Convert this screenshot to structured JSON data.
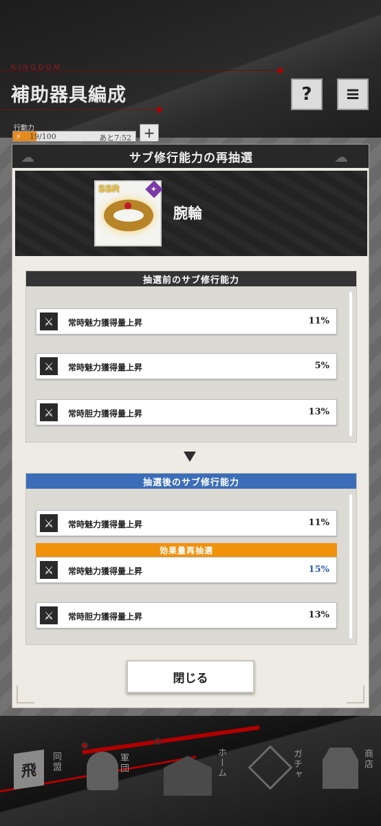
{
  "screen": {
    "brand": "KINGDOM",
    "title": "補助器具編成",
    "help_label": "?",
    "menu_label": "≡",
    "stamina": {
      "label": "行動力",
      "value": "19/100",
      "recover": "あと7:52",
      "fill_fraction": 0.19,
      "plus_label": "+"
    }
  },
  "modal": {
    "title": "サブ修行能力の再抽選",
    "item": {
      "rarity": "SSR",
      "name": "腕輪"
    },
    "before": {
      "header": "抽選前のサブ修行能力",
      "rows": [
        {
          "name": "常時魅力獲得量上昇",
          "value": "11%"
        },
        {
          "name": "常時魅力獲得量上昇",
          "value": "5%"
        },
        {
          "name": "常時胆力獲得量上昇",
          "value": "13%"
        }
      ]
    },
    "after": {
      "header": "抽選後のサブ修行能力",
      "reroll_banner": "効果量再抽選",
      "rows": [
        {
          "name": "常時魅力獲得量上昇",
          "value": "11%"
        },
        {
          "name": "常時魅力獲得量上昇",
          "value": "15%"
        },
        {
          "name": "常時胆力獲得量上昇",
          "value": "13%"
        }
      ]
    },
    "close_label": "閉じる"
  },
  "nav": {
    "items": [
      {
        "label": "同盟",
        "icon": "alliance-flag-icon",
        "glyph": "飛"
      },
      {
        "label": "軍団",
        "icon": "helmet-icon"
      },
      {
        "label": "ホーム",
        "icon": "castle-gate-icon"
      },
      {
        "label": "ガチャ",
        "icon": "gacha-crest-icon"
      },
      {
        "label": "商店",
        "icon": "shop-building-icon"
      }
    ]
  },
  "colors": {
    "accent_red": "#b00000",
    "header_blue": "#3b6db8",
    "reroll_orange": "#f0920c",
    "stamina_orange": "#e58a1e"
  }
}
